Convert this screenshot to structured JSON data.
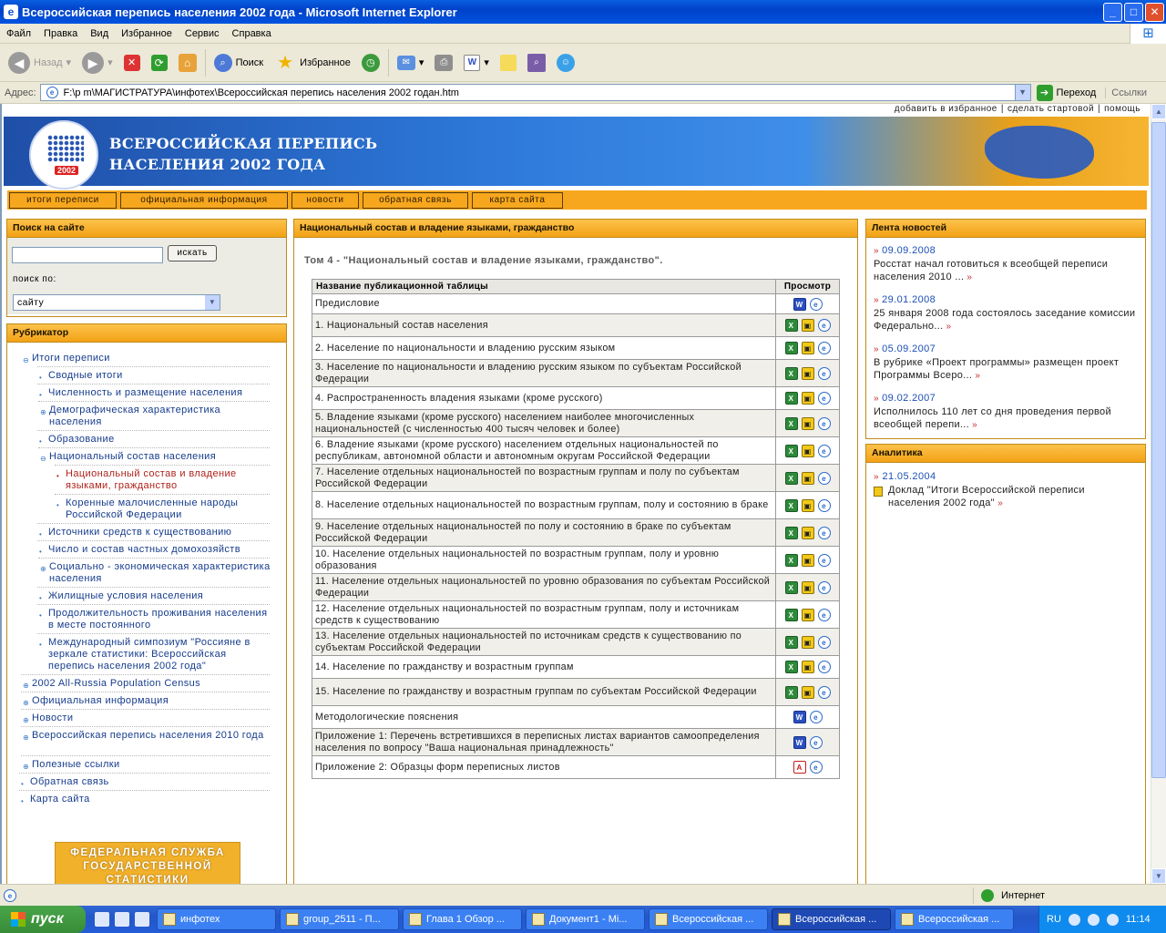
{
  "window": {
    "title": "Всероссийская перепись населения 2002 года - Microsoft Internet Explorer"
  },
  "menu": [
    "Файл",
    "Правка",
    "Вид",
    "Избранное",
    "Сервис",
    "Справка"
  ],
  "toolbar": {
    "back": "Назад",
    "search": "Поиск",
    "favorites": "Избранное"
  },
  "address": {
    "label": "Адрес:",
    "url": "F:\\p m\\МАГИСТРАТУРА\\инфотех\\Всероссийская перепись населения 2002 годан.htm",
    "go": "Переход",
    "links": "Ссылки"
  },
  "site": {
    "toplinks": [
      "добавить в избранное",
      "сделать стартовой",
      "помощь"
    ],
    "banner_line1": "ВСЕРОССИЙСКАЯ ПЕРЕПИСЬ",
    "banner_line2": "НАСЕЛЕНИЯ 2002 ГОДА",
    "logo_year": "2002",
    "nav": [
      "итоги переписи",
      "официальная информация",
      "новости",
      "обратная связь",
      "карта сайта"
    ],
    "search": {
      "title": "Поиск на сайте",
      "button": "искать",
      "by_label": "поиск по:",
      "scope": "сайту"
    },
    "rubricator": {
      "title": "Рубрикатор",
      "items": [
        "Итоги переписи",
        "Сводные итоги",
        "Численность и размещение населения",
        "Демографическая характеристика населения",
        "Образование",
        "Национальный состав населения",
        "Национальный состав и владение языками, гражданство",
        "Коренные малочисленные народы Российской Федерации",
        "Источники средств к существованию",
        "Число и состав частных домохозяйств",
        "Социально - экономическая характеристика населения",
        "Жилищные условия населения",
        "Продолжительность проживания населения в месте постоянного",
        "Международный симпозиум \"Россияне в зеркале статистики: Всероссийская перепись населения 2002 года\"",
        "2002 All-Russia Population Census",
        "Официальная информация",
        "Новости",
        "Всероссийская перепись населения 2010 года",
        "Полезные ссылки",
        "Обратная связь",
        "Карта сайта"
      ]
    },
    "fsgs": "ФЕДЕРАЛЬНАЯ СЛУЖБА ГОСУДАРСТВЕННОЙ СТАТИСТИКИ",
    "main": {
      "header": "Национальный состав и владение языками, гражданство",
      "title": "Том 4 - \"Национальный состав и владение языками, гражданство\".",
      "col_name": "Название публикационной таблицы",
      "col_view": "Просмотр",
      "rows": [
        "Предисловие",
        "1. Национальный состав населения",
        "2. Население по национальности и владению русским языком",
        "3. Население по национальности и владению русским языком по субъектам Российской Федерации",
        "4. Распространенность владения языками (кроме русского)",
        "5. Владение языками (кроме русского) населением наиболее многочисленных национальностей (с численностью 400 тысяч человек и более)",
        "6. Владение языками (кроме русского) населением отдельных национальностей по республикам, автономной области и автономным округам Российской Федерации",
        "7. Население отдельных национальностей по возрастным группам и полу по субъектам Российской Федерации",
        "8. Население отдельных национальностей по возрастным группам, полу и состоянию в браке",
        "9. Население отдельных национальностей по полу и состоянию в браке по субъектам Российской Федерации",
        "10. Население отдельных национальностей по возрастным группам, полу и уровню образования",
        "11. Население отдельных национальностей по уровню образования по субъектам Российской Федерации",
        "12. Население отдельных национальностей по возрастным группам, полу и источникам средств к существованию",
        "13. Население отдельных национальностей по источникам средств к существованию по субъектам Российской Федерации",
        "14. Население по гражданству и возрастным группам",
        "15. Население по гражданству и возрастным группам по субъектам Российской Федерации",
        "Методологические пояснения",
        "Приложение 1: Перечень встретившихся в переписных листах вариантов самоопределения населения по вопросу \"Ваша национальная принадлежность\"",
        "Приложение 2: Образцы форм переписных листов"
      ]
    },
    "news": {
      "title": "Лента новостей",
      "items": [
        {
          "date": "09.09.2008",
          "text": "Росстат начал готовиться к всеобщей переписи населения 2010 ..."
        },
        {
          "date": "29.01.2008",
          "text": "25 января 2008 года состоялось заседание комиссии Федерально..."
        },
        {
          "date": "05.09.2007",
          "text": "В рубрике «Проект программы» размещен проект Программы Всеро..."
        },
        {
          "date": "09.02.2007",
          "text": "Исполнилось 110 лет со дня проведения первой всеобщей перепи..."
        }
      ]
    },
    "analytics": {
      "title": "Аналитика",
      "date": "21.05.2004",
      "text": "Доклад \"Итоги Всероссийской переписи населения 2002 года\""
    }
  },
  "status": {
    "zone": "Интернет"
  },
  "taskbar": {
    "start": "пуск",
    "tasks": [
      "инфотех",
      "group_2511 - П...",
      "Глава 1 Обзор ...",
      "Документ1 - Mi...",
      "Всероссийская ...",
      "Всероссийская ...",
      "Всероссийская ..."
    ],
    "lang": "RU",
    "time": "11:14"
  }
}
